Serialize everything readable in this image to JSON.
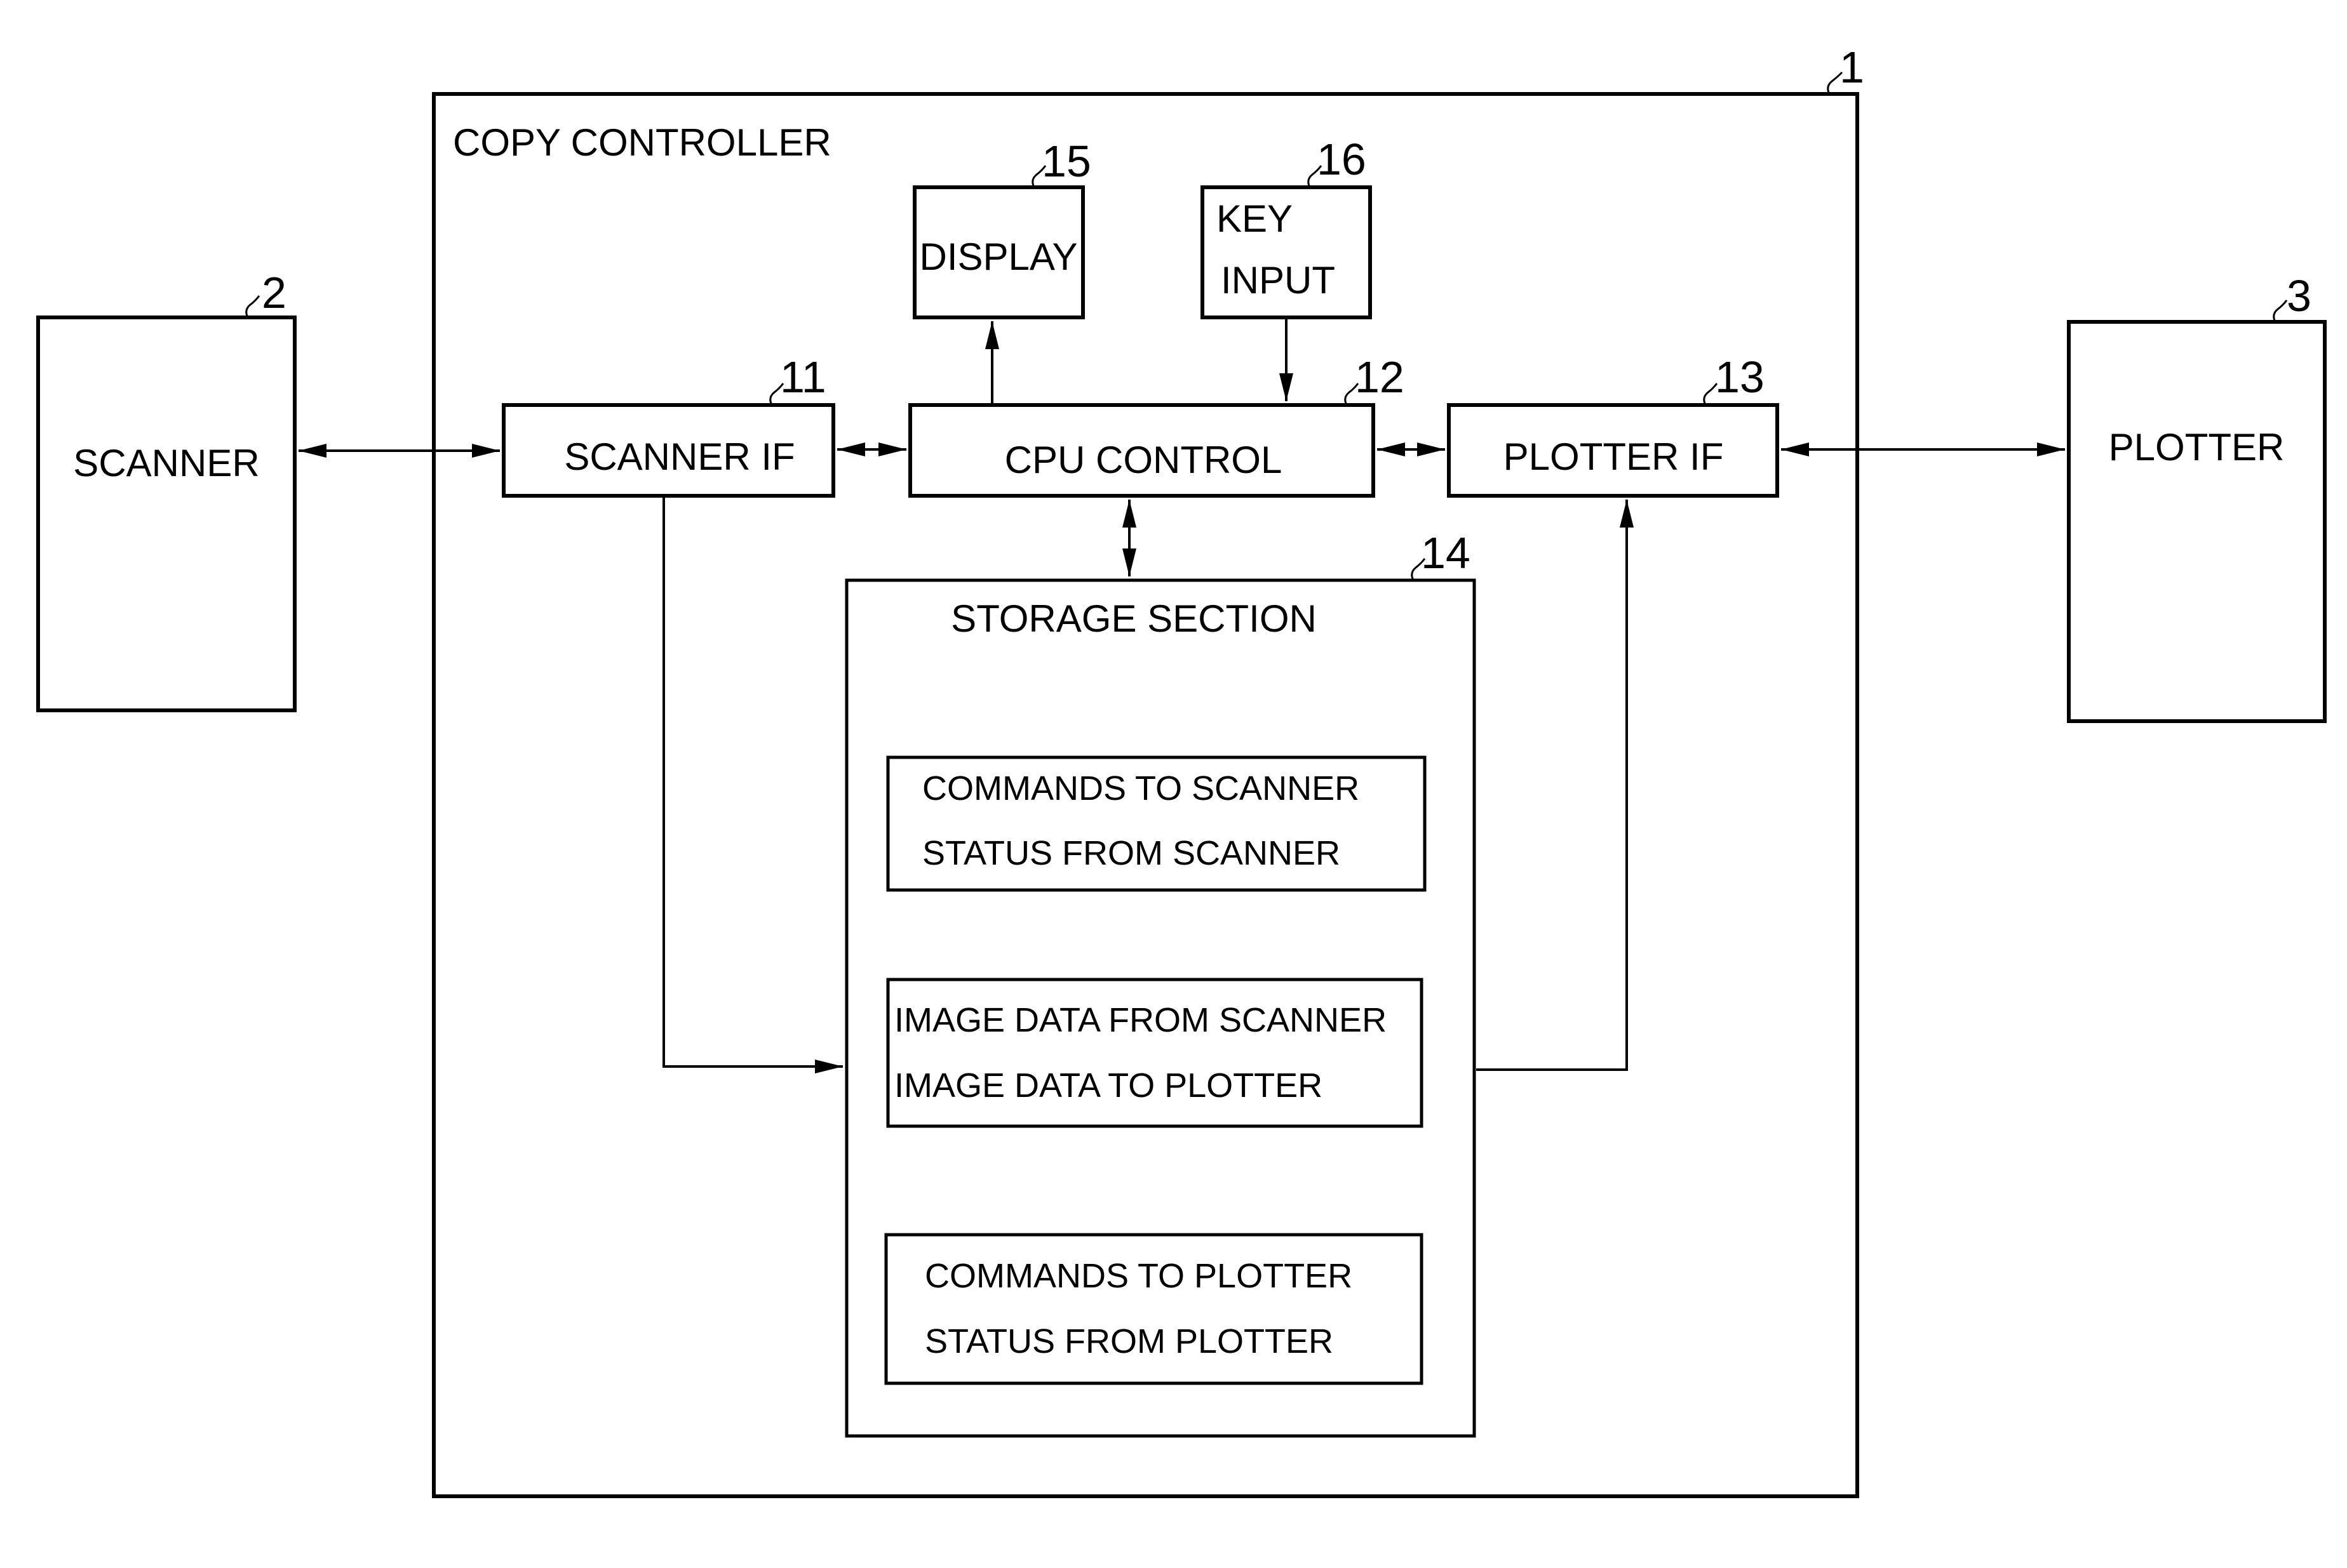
{
  "diagram": {
    "controller": {
      "ref": "1",
      "label": "COPY CONTROLLER"
    },
    "scanner": {
      "ref": "2",
      "label": "SCANNER"
    },
    "plotter": {
      "ref": "3",
      "label": "PLOTTER"
    },
    "scanner_if": {
      "ref": "11",
      "label": "SCANNER IF"
    },
    "cpu_control": {
      "ref": "12",
      "label": "CPU CONTROL"
    },
    "plotter_if": {
      "ref": "13",
      "label": "PLOTTER IF"
    },
    "storage": {
      "ref": "14",
      "label": "STORAGE SECTION",
      "areas": [
        {
          "lines": [
            "COMMANDS TO SCANNER",
            "STATUS FROM SCANNER"
          ]
        },
        {
          "lines": [
            "IMAGE DATA FROM SCANNER",
            "IMAGE DATA TO PLOTTER"
          ]
        },
        {
          "lines": [
            "COMMANDS TO PLOTTER",
            "STATUS FROM PLOTTER"
          ]
        }
      ]
    },
    "display": {
      "ref": "15",
      "label": "DISPLAY"
    },
    "key_input": {
      "ref": "16",
      "label_line1": "KEY",
      "label_line2": "INPUT"
    },
    "connections": [
      {
        "from": "SCANNER",
        "to": "SCANNER IF",
        "direction": "bidirectional"
      },
      {
        "from": "SCANNER IF",
        "to": "CPU CONTROL",
        "direction": "bidirectional"
      },
      {
        "from": "CPU CONTROL",
        "to": "PLOTTER IF",
        "direction": "bidirectional"
      },
      {
        "from": "PLOTTER IF",
        "to": "PLOTTER",
        "direction": "bidirectional"
      },
      {
        "from": "CPU CONTROL",
        "to": "DISPLAY",
        "direction": "forward"
      },
      {
        "from": "KEY INPUT",
        "to": "CPU CONTROL",
        "direction": "forward"
      },
      {
        "from": "CPU CONTROL",
        "to": "STORAGE SECTION",
        "direction": "bidirectional"
      },
      {
        "from": "SCANNER IF",
        "to": "IMAGE DATA area",
        "direction": "forward"
      },
      {
        "from": "IMAGE DATA area",
        "to": "PLOTTER IF",
        "direction": "forward"
      }
    ]
  }
}
